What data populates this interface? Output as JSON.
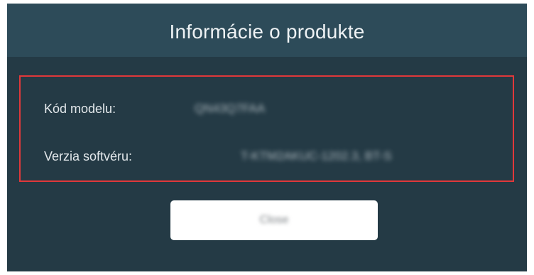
{
  "dialog": {
    "title": "Informácie o produkte",
    "model": {
      "label": "Kód modelu:",
      "value": "QN43Q7FAA"
    },
    "software": {
      "label": "Verzia softvéru:",
      "value": "T-KTM2AKUC-1202.3, BT-S"
    },
    "close_label": "Close"
  },
  "colors": {
    "dialog_background": "#243a45",
    "title_bar_background": "#2d4b59",
    "highlight_border": "#e0383a",
    "button_background": "#ffffff"
  }
}
